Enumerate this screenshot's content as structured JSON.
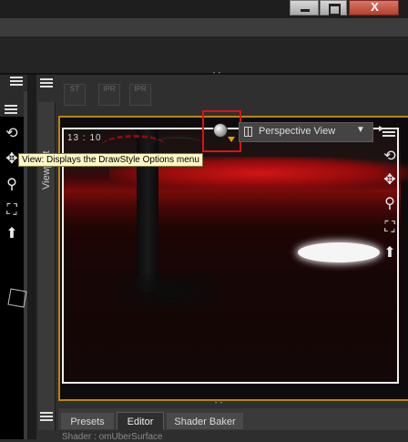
{
  "window": {
    "close_label": "X"
  },
  "toolbar_icons": [
    {
      "label": "ST",
      "icon": "render-settings-icon"
    },
    {
      "label": "IPR",
      "icon": "ipr-icon"
    },
    {
      "label": "IPR",
      "icon": "ipr-render-icon"
    }
  ],
  "viewport": {
    "tab_label": "Viewport",
    "timecode": "13 : 10",
    "camera_label": "Perspective View",
    "camera_arrow": "▼",
    "draw_style_icon": "draw-style-sphere-icon",
    "menu_arrow": "►",
    "tooltip": "View: Displays the DrawStyle Options menu",
    "nav_icons": [
      "orbit-icon",
      "pan-icon",
      "zoom-icon",
      "frame-icon",
      "reset-view-icon"
    ],
    "colors": {
      "frame": "#b8860b",
      "highlight_box": "#e01010",
      "tooltip_bg": "#fcf7c4"
    }
  },
  "left_nav": {
    "icons": [
      "orbit-icon",
      "pan-icon",
      "zoom-icon",
      "frame-icon",
      "reset-view-icon",
      "cube-icon"
    ]
  },
  "bottom_tabs": {
    "tabs": [
      "Presets",
      "Editor",
      "Shader Baker"
    ],
    "active": "Editor",
    "content_line": "Shader : omUberSurface"
  }
}
